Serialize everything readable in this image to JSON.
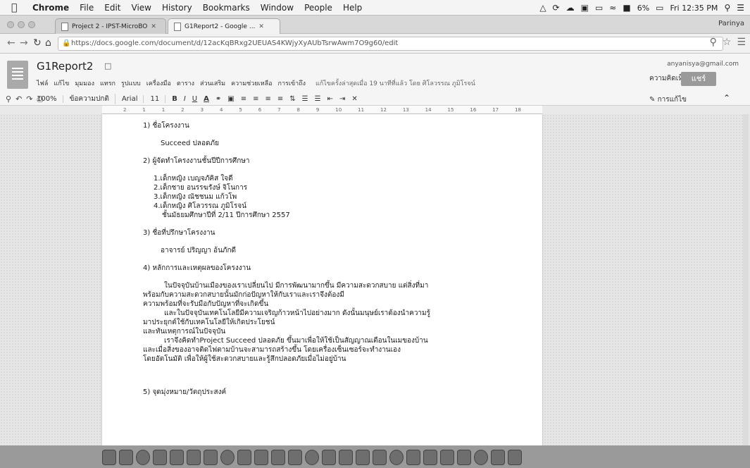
{
  "menubar": {
    "app": "Chrome",
    "items": [
      "File",
      "Edit",
      "View",
      "History",
      "Bookmarks",
      "Window",
      "People",
      "Help"
    ],
    "battery": "6%",
    "clock": "Fri 12:35 PM"
  },
  "tabs": [
    {
      "title": "Project 2 - IPST-MicroBO"
    },
    {
      "title": "G1Report2 - Google ..."
    }
  ],
  "profile_name": "Parinya",
  "address": {
    "url": "https://docs.google.com/document/d/12acKqBRxg2UEUAS4KWjyXyAUbTsrwAwm7O9g60/edit"
  },
  "docs": {
    "title": "G1Report2",
    "menus": [
      "ไฟล์",
      "แก้ไข",
      "มุมมอง",
      "แทรก",
      "รูปแบบ",
      "เครื่องมือ",
      "ตาราง",
      "ส่วนเสริม",
      "ความช่วยเหลือ",
      "การเข้าถึง"
    ],
    "last_edit": "แก้ไขครั้งล่าสุดเมื่อ 19 นาทีที่แล้ว โดย ศิโลวรรณ ภูมิโรจน์",
    "account": "anyanisya@gmail.com",
    "comments_label": "ความคิดเห็น",
    "share_label": "แชร์",
    "edit_mode_label": "การแก้ไข",
    "toolbar": {
      "zoom": "100%",
      "style": "ข้อความปกติ",
      "font": "Arial",
      "size": "11",
      "bold": "B",
      "italic": "I",
      "underline": "U",
      "text_color": "A"
    },
    "ruler": [
      "2",
      "1",
      "1",
      "2",
      "3",
      "4",
      "5",
      "6",
      "7",
      "8",
      "9",
      "10",
      "11",
      "12",
      "13",
      "14",
      "15",
      "16",
      "17",
      "18"
    ]
  },
  "content": {
    "h1": "1) ชื่อโครงงาน",
    "project_name": "Succeed ปลอดภัย",
    "h2": "2) ผู้จัดทำโครงงานชั้นปีปีการศึกษา",
    "members": [
      "1.เด็กหญิง เบญจภัคิส    ใจดี",
      "2.เด็กชาย อนรรฆรังษ์     จิโนการ",
      "3.เด็กหญิง ณัชชนม     แก้วโพ",
      "4.เด็กหญิง ศิโลวรรณ    ภูมิโรจน์"
    ],
    "grade": "ชั้นมัธยมศึกษาปีที่ 2/11 ปีการศึกษา 2557",
    "h3": "3) ชื่อที่ปรึกษาโครงงาน",
    "advisor": "อาจารย์ ปริญญา   อ้นภักดี",
    "h4": "4) หลักการและเหตุผลของโครงงาน",
    "p1a": "ในปัจจุบันบ้านเมืองของเราเปลี่ยนไป มีการพัฒนามากขึ้น มีความสะดวกสบาย แต่สิ่งที่มา",
    "p1b": "พร้อมกับความสะดวกสบายนั้นมักก่อปัญหาให้กับเราและเราจึงต้องมี",
    "p1c": "ความพร้อมที่จะรับมือกับปัญหาที่จะเกิดขึ้น",
    "p2a": "และในปัจจุบันเทคโนโลยีมีความเจริญก้าวหน้าไปอย่างมาก ดังนั้นมนุษย์เราต้องนำความรู้",
    "p2b": "มาประยุกต์ใช้กับเทคโนโลยีให้เกิดประโยชน์",
    "p2c": "และทันเหตุการณ์ในปัจจุบัน",
    "p3a": "เราจึงคิดทำProject Succeed ปลอดภัย ขึ้นมาเพื่อให้ใช้เป็นสัญญาณเตือนในเมของบ้าน",
    "p3b": "และเมื่อสิ่งของอาจติดไฟตามบ้านจะสามารถสร้างขึ้น โดยเครื่องเซ็นเซอร์จะทำงานเอง",
    "p3c": "โดยอัตโนมัติ เพื่อให้ผู้ใช้สะดวกสบายและรู้สึกปลอดภัยเมื่อไม่อยู่บ้าน",
    "h5": "5) จุดมุ่งหมาย/วัตถุประสงค์"
  },
  "dock_apps": [
    "finder",
    "launchpad",
    "safari",
    "chrome",
    "mail",
    "contacts",
    "calendar",
    "notes",
    "reminders",
    "maps",
    "photos",
    "messages",
    "facetime",
    "itunes",
    "ibooks",
    "appstore",
    "prefs",
    "word",
    "excel",
    "powerpoint",
    "ps",
    "ai",
    "lr",
    "id",
    "trash"
  ]
}
